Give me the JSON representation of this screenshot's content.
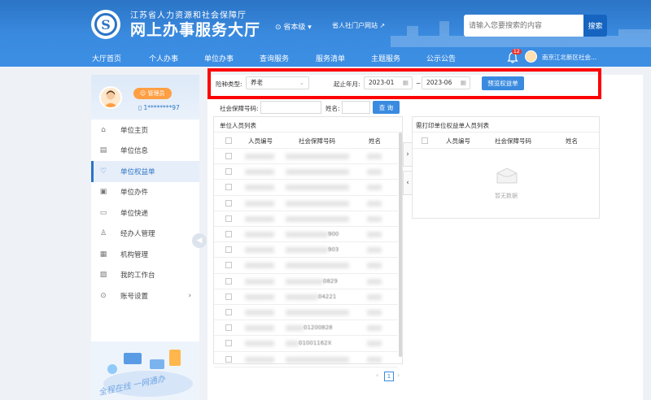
{
  "header": {
    "org_name": "江苏省人力资源和社会保障厅",
    "site_name": "网上办事服务大厅",
    "region": "省本级",
    "portal_link": "省人社门户网站",
    "search_placeholder": "请输入您要搜索的内容",
    "search_button": "搜索",
    "notification_count": "12",
    "user_name": "南京江北新区社会..."
  },
  "nav": [
    "大厅首页",
    "个人办事",
    "单位办事",
    "查询服务",
    "服务清单",
    "主题服务",
    "公示公告"
  ],
  "sidebar": {
    "role_badge": "管理员",
    "account": "1********97",
    "items": [
      {
        "label": "单位主页",
        "icon": "home-icon"
      },
      {
        "label": "单位信息",
        "icon": "document-icon"
      },
      {
        "label": "单位权益单",
        "icon": "shield-icon"
      },
      {
        "label": "单位办件",
        "icon": "file-icon"
      },
      {
        "label": "单位快递",
        "icon": "truck-icon"
      },
      {
        "label": "经办人管理",
        "icon": "user-icon"
      },
      {
        "label": "机构管理",
        "icon": "building-icon"
      },
      {
        "label": "我的工作台",
        "icon": "chart-icon"
      },
      {
        "label": "账号设置",
        "icon": "gear-icon"
      }
    ],
    "active_index": 2,
    "illustration_text": "全程在线 一网通办"
  },
  "filters": {
    "insurance_type_label": "险种类型:",
    "insurance_type_value": "养老",
    "period_label": "起止年月:",
    "start_month": "2023-01",
    "separator": "~",
    "end_month": "2023-06",
    "preview_button": "预览权益单"
  },
  "search": {
    "ssn_label": "社会保障号码:",
    "name_label": "姓名:",
    "query_button": "查 询"
  },
  "left_table": {
    "title": "单位人员列表",
    "columns": [
      "人员编号",
      "社会保障号码",
      "姓名"
    ],
    "visible_fragments": [
      "900",
      "903",
      "0829",
      "04221",
      "01200828",
      "01001162X"
    ]
  },
  "right_table": {
    "title": "需打印单位权益单人员列表",
    "columns": [
      "人员编号",
      "社会保障号码",
      "姓名"
    ],
    "empty_text": "暂无数据"
  },
  "pagination": {
    "current": "1"
  }
}
